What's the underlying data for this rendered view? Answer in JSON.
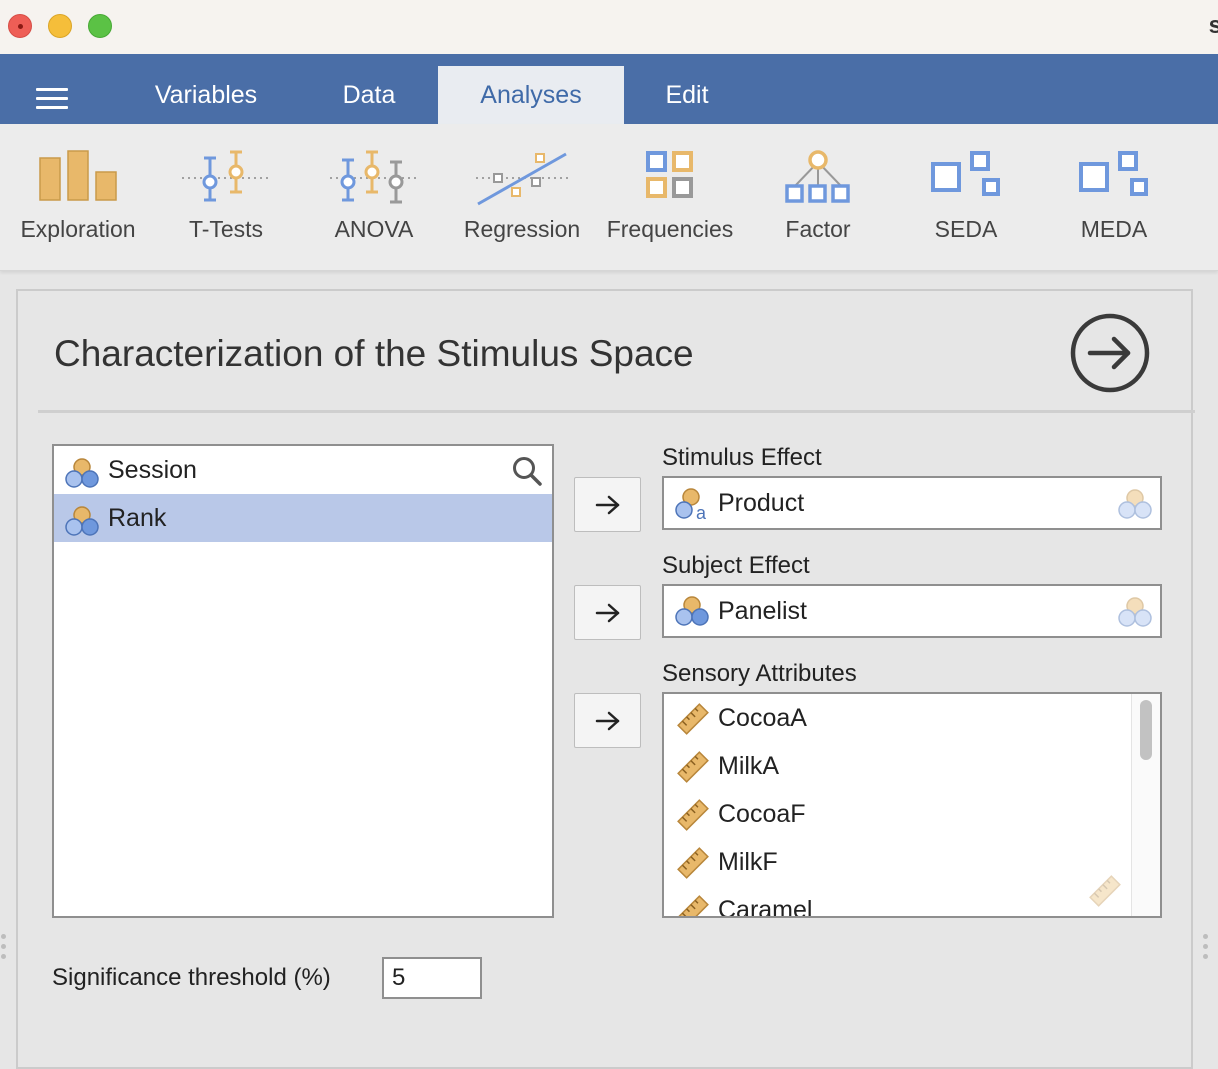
{
  "window": {
    "title_peek": "s"
  },
  "menu": {
    "tabs": [
      {
        "label": "Variables"
      },
      {
        "label": "Data"
      },
      {
        "label": "Analyses"
      },
      {
        "label": "Edit"
      }
    ]
  },
  "ribbon": {
    "buttons": [
      {
        "label": "Exploration",
        "icon": "exploration-icon"
      },
      {
        "label": "T-Tests",
        "icon": "t-tests-icon"
      },
      {
        "label": "ANOVA",
        "icon": "anova-icon"
      },
      {
        "label": "Regression",
        "icon": "regression-icon"
      },
      {
        "label": "Frequencies",
        "icon": "frequencies-icon"
      },
      {
        "label": "Factor",
        "icon": "factor-icon"
      },
      {
        "label": "SEDA",
        "icon": "seda-icon"
      },
      {
        "label": "MEDA",
        "icon": "meda-icon"
      }
    ]
  },
  "panel": {
    "title": "Characterization of the Stimulus Space",
    "available_variables": [
      {
        "name": "Session",
        "selected": false
      },
      {
        "name": "Rank",
        "selected": true
      }
    ],
    "stimulus_effect": {
      "label": "Stimulus Effect",
      "value": "Product"
    },
    "subject_effect": {
      "label": "Subject Effect",
      "value": "Panelist"
    },
    "sensory_attributes": {
      "label": "Sensory Attributes",
      "items": [
        "CocoaA",
        "MilkA",
        "CocoaF",
        "MilkF",
        "Caramel"
      ]
    },
    "significance": {
      "label": "Significance threshold (%)",
      "value": "5"
    }
  },
  "colors": {
    "menubar": "#4a6ea7",
    "selected_row": "#b9c8e8",
    "nominal_orange": "#e8b86a",
    "nominal_blue": "#6f98dd"
  }
}
